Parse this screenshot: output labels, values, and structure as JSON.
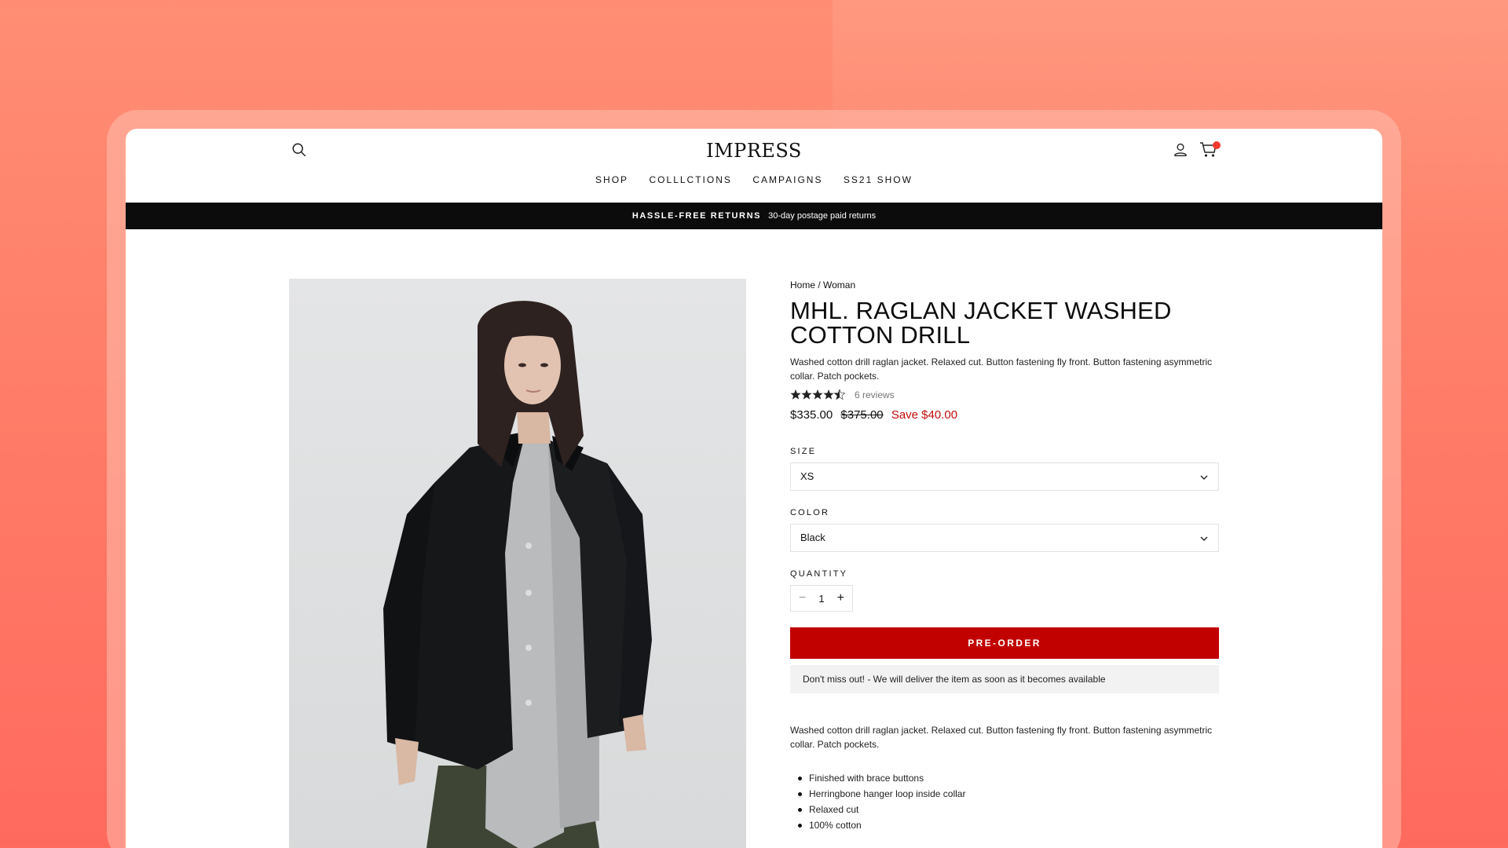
{
  "brand": "IMPRESS",
  "nav": [
    "SHOP",
    "COLLLCTIONS",
    "CAMPAIGNS",
    "SS21 SHOW"
  ],
  "announcement": {
    "bold": "HASSLE-FREE RETURNS",
    "text": "30-day postage paid returns"
  },
  "icons": {
    "search": "search-icon",
    "account": "user-icon",
    "cart": "cart-icon",
    "cart_badge_color": "#f23a2e"
  },
  "product": {
    "breadcrumb": "Home / Woman",
    "title": "MHL. RAGLAN JACKET WASHED COTTON DRILL",
    "short_description": "Washed cotton drill raglan jacket. Relaxed cut. Button fastening fly front. Button fastening asymmetric collar. Patch pockets.",
    "rating_value": 4.5,
    "reviews": "6 reviews",
    "price": "$335.00",
    "compare_price": "$375.00",
    "save": "Save $40.00",
    "size_label": "SIZE",
    "size_value": "XS",
    "color_label": "COLOR",
    "color_value": "Black",
    "quantity_label": "QUANTITY",
    "quantity_value": "1",
    "cta": "PRE-ORDER",
    "notice": "Don't miss out! - We will deliver the item as soon as it becomes available",
    "long_description": "Washed cotton drill raglan jacket. Relaxed cut. Button fastening fly front. Button fastening asymmetric collar. Patch pockets.",
    "features": [
      "Finished with brace buttons",
      "Herringbone hanger loop inside collar",
      "Relaxed cut",
      "100% cotton"
    ]
  },
  "colors": {
    "accent": "#c10000",
    "sale": "#c20c0c",
    "announcement_bg": "#0c0c0c"
  }
}
